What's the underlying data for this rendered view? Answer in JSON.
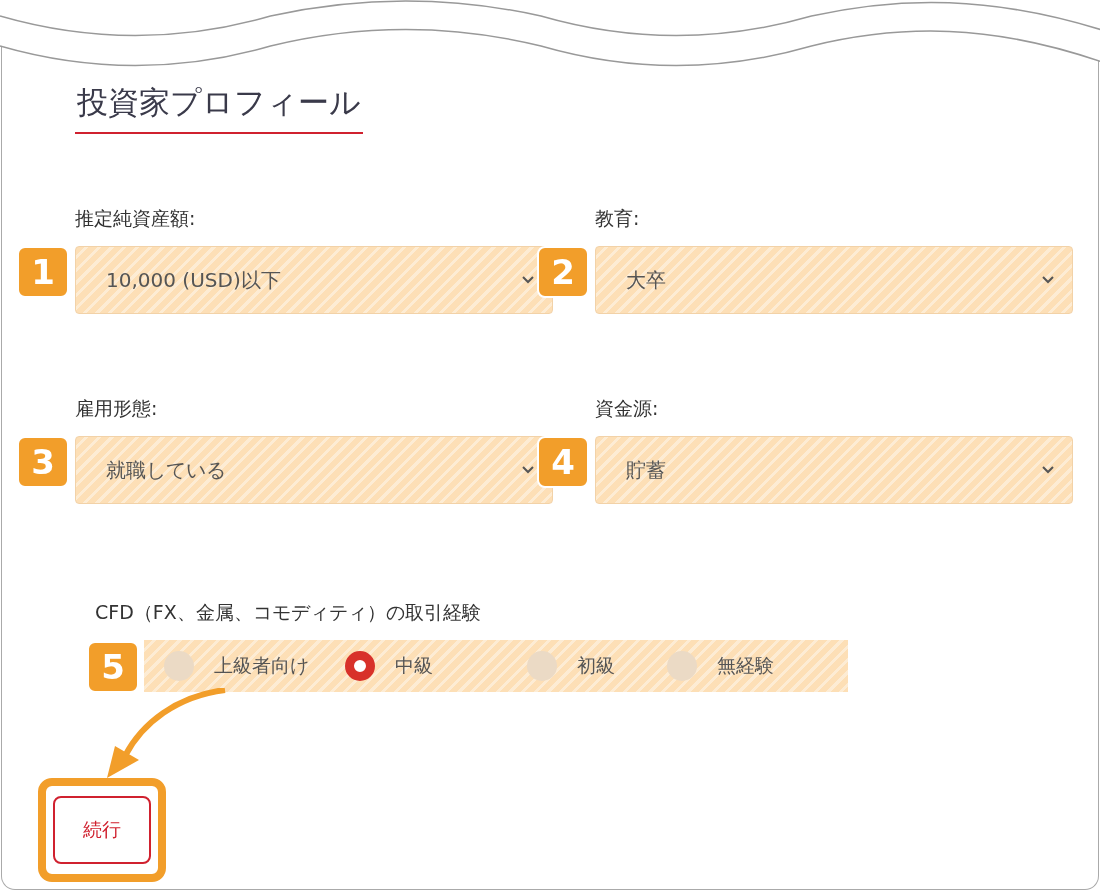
{
  "title": "投資家プロフィール",
  "fields": [
    {
      "label": "推定純資産額:",
      "value": "10,000 (USD)以下",
      "badge": "1"
    },
    {
      "label": "教育:",
      "value": "大卒",
      "badge": "2"
    },
    {
      "label": "雇用形態:",
      "value": "就職している",
      "badge": "3"
    },
    {
      "label": "資金源:",
      "value": "貯蓄",
      "badge": "4"
    }
  ],
  "experience": {
    "label": "CFD（FX、金属、コモディティ）の取引経験",
    "badge": "5",
    "options": [
      {
        "label": "上級者向け",
        "selected": false
      },
      {
        "label": "中級",
        "selected": true
      },
      {
        "label": "初級",
        "selected": false
      },
      {
        "label": "無経験",
        "selected": false
      }
    ]
  },
  "continue_button": {
    "label": "続行"
  }
}
